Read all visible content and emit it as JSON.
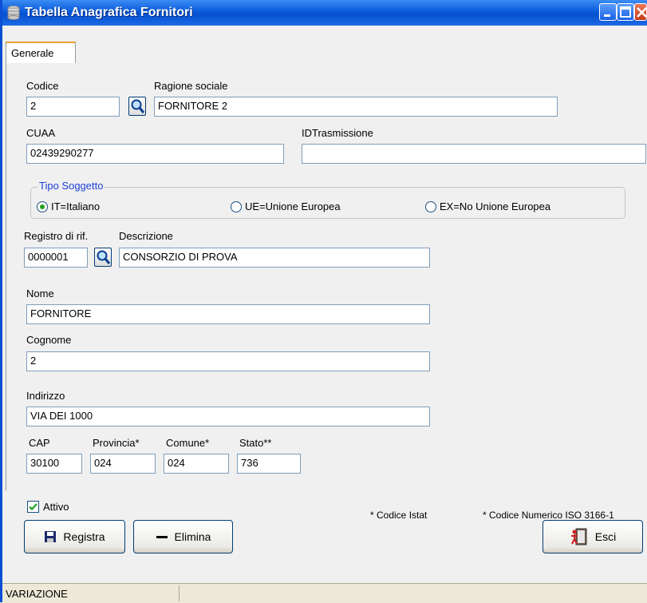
{
  "window": {
    "title": "Tabella Anagrafica Fornitori"
  },
  "tabs": [
    {
      "label": "Generale"
    }
  ],
  "form": {
    "codice": {
      "label": "Codice",
      "value": "2"
    },
    "ragione_sociale": {
      "label": "Ragione sociale",
      "value": "FORNITORE 2"
    },
    "cuaa": {
      "label": "CUAA",
      "value": "02439290277"
    },
    "id_trasmissione": {
      "label": "IDTrasmissione",
      "value": ""
    },
    "tipo_soggetto": {
      "title": "Tipo Soggetto",
      "options": [
        {
          "label": "IT=Italiano",
          "selected": true
        },
        {
          "label": "UE=Unione Europea",
          "selected": false
        },
        {
          "label": "EX=No Unione Europea",
          "selected": false
        }
      ]
    },
    "registro": {
      "label": "Registro di rif.",
      "value": "0000001"
    },
    "descrizione": {
      "label": "Descrizione",
      "value": "CONSORZIO DI PROVA"
    },
    "nome": {
      "label": "Nome",
      "value": "FORNITORE"
    },
    "cognome": {
      "label": "Cognome",
      "value": "2"
    },
    "indirizzo": {
      "label": "Indirizzo",
      "value": "VIA DEI 1000"
    },
    "cap": {
      "label": "CAP",
      "value": "30100"
    },
    "provincia": {
      "label": "Provincia*",
      "value": "024"
    },
    "comune": {
      "label": "Comune*",
      "value": "024"
    },
    "stato": {
      "label": "Stato**",
      "value": "736"
    },
    "attivo": {
      "label": "Attivo",
      "checked": true
    },
    "notes": {
      "istat": "* Codice Istat",
      "iso": "* Codice Numerico ISO 3166-1"
    }
  },
  "buttons": {
    "registra": "Registra",
    "elimina": "Elimina",
    "esci": "Esci"
  },
  "status": {
    "mode": "VARIAZIONE"
  },
  "colors": {
    "accent": "#0a5bdc",
    "group_title": "#1a3fd6",
    "radio_dot": "#21a121"
  }
}
